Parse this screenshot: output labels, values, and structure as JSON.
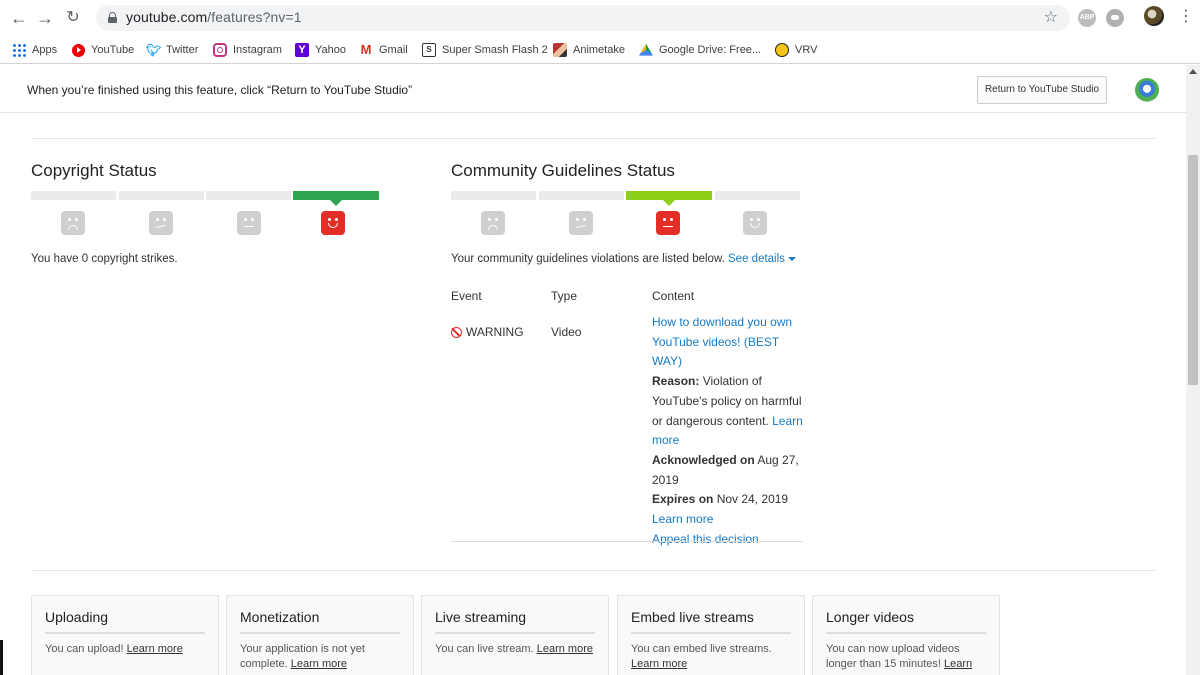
{
  "browser": {
    "url_host": "youtube.com",
    "url_path": "/features?nv=1",
    "bookmarks": [
      {
        "label": "Apps",
        "icon": "apps-grid-icon"
      },
      {
        "label": "YouTube",
        "icon": "youtube-icon"
      },
      {
        "label": "Twitter",
        "icon": "twitter-icon"
      },
      {
        "label": "Instagram",
        "icon": "instagram-icon"
      },
      {
        "label": "Yahoo",
        "icon": "yahoo-icon"
      },
      {
        "label": "Gmail",
        "icon": "gmail-icon"
      },
      {
        "label": "Super Smash Flash 2",
        "icon": "ssf2-icon"
      },
      {
        "label": "Animetake",
        "icon": "animetake-icon"
      },
      {
        "label": "Google Drive: Free...",
        "icon": "google-drive-icon"
      },
      {
        "label": "VRV",
        "icon": "vrv-icon"
      }
    ],
    "extensions": {
      "abp": "ABP"
    }
  },
  "banner": {
    "message": "When you’re finished using this feature, click “Return to YouTube Studio”",
    "return_button": "Return to YouTube Studio"
  },
  "copyright": {
    "title": "Copyright Status",
    "active_level": 4,
    "levels": 4,
    "summary": "You have 0 copyright strikes."
  },
  "community": {
    "title": "Community Guidelines Status",
    "active_level": 3,
    "levels": 4,
    "summary": "Your community guidelines violations are listed below.",
    "see_details": "See details",
    "table": {
      "headers": {
        "event": "Event",
        "type": "Type",
        "content": "Content"
      },
      "row": {
        "event": "WARNING",
        "type": "Video",
        "video_title": "How to download you own YouTube videos! (BEST WAY)",
        "reason_label": "Reason:",
        "reason_text": "Violation of YouTube's policy on harmful or dangerous content.",
        "reason_link": "Learn more",
        "ack_label": "Acknowledged on",
        "ack_date": "Aug 27, 2019",
        "expires_label": "Expires on",
        "expires_date": "Nov 24, 2019",
        "learn_more": "Learn more",
        "appeal": "Appeal this decision"
      }
    }
  },
  "features": [
    {
      "title": "Uploading",
      "text": "You can upload!",
      "link": "Learn more"
    },
    {
      "title": "Monetization",
      "text": "Your application is not yet complete.",
      "link": "Learn more"
    },
    {
      "title": "Live streaming",
      "text": "You can live stream.",
      "link": "Learn more"
    },
    {
      "title": "Embed live streams",
      "text": "You can embed live streams.",
      "link": "Learn more"
    },
    {
      "title": "Longer videos",
      "text": "You can now upload videos longer than 15 minutes!",
      "link": "Learn more"
    }
  ],
  "colors": {
    "copyright_active": "#2ea44f",
    "community_active": "#8cd018",
    "strike_face": "#e52d27",
    "link": "#167ac6"
  }
}
